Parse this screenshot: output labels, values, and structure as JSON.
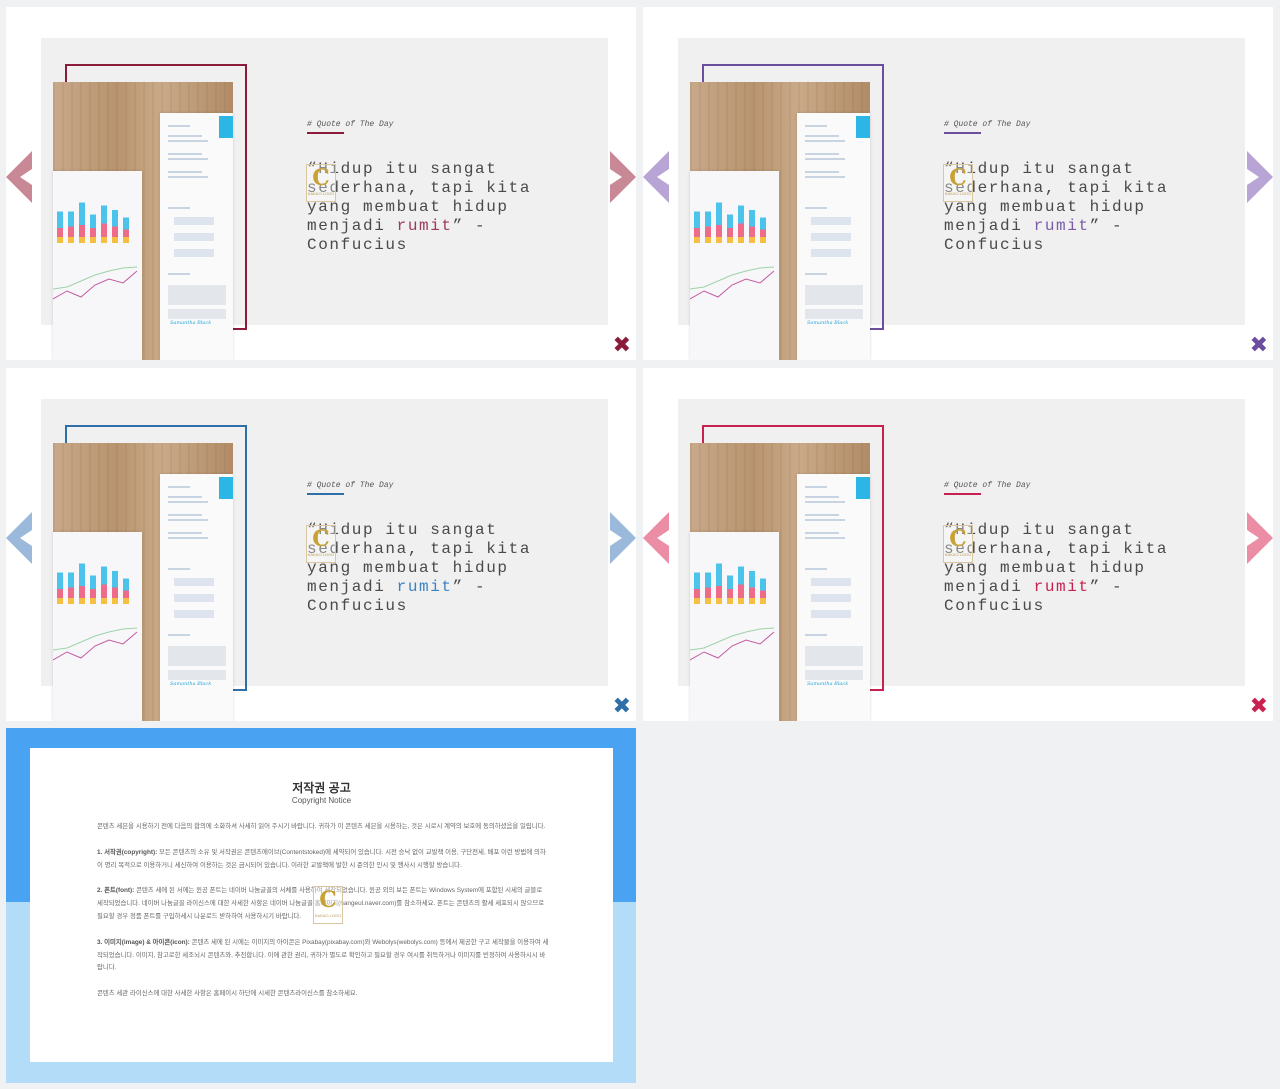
{
  "slides": [
    {
      "accent": "#8a1c3a",
      "accent2": "#9b3a59",
      "arrow_color": "#c98896",
      "quote_tag": "# Quote of The Day",
      "quote_text": "“Hidup itu sangat sederhana, tapi kita yang membuat hidup menjadi ",
      "quote_highlight": "rumit",
      "quote_end": "” -Confucius"
    },
    {
      "accent": "#6b4f9e",
      "accent2": "#7a5ca8",
      "arrow_color": "#b8a5d6",
      "quote_tag": "# Quote of The Day",
      "quote_text": "“Hidup itu sangat sederhana, tapi kita yang membuat hidup menjadi ",
      "quote_highlight": "rumit",
      "quote_end": "” -Confucius"
    },
    {
      "accent": "#2f6fa8",
      "accent2": "#3b82c4",
      "arrow_color": "#9ab9db",
      "quote_tag": "# Quote of The Day",
      "quote_text": "“Hidup itu sangat sederhana, tapi kita yang membuat hidup menjadi ",
      "quote_highlight": "rumit",
      "quote_end": "” -Confucius"
    },
    {
      "accent": "#c8214f",
      "accent2": "#c8214f",
      "arrow_color": "#ec8da6",
      "quote_tag": "# Quote of The Day",
      "quote_text": "“Hidup itu sangat sederhana, tapi kita yang membuat hidup menjadi ",
      "quote_highlight": "rumit",
      "quote_end": "” -Confucius"
    }
  ],
  "photo": {
    "signature": "Samantha Black",
    "bars_cyan": [
      0.55,
      0.5,
      0.75,
      0.45,
      0.6,
      0.55,
      0.4
    ],
    "bars_pink": [
      0.3,
      0.35,
      0.4,
      0.3,
      0.45,
      0.35,
      0.25
    ],
    "bars_yellow": [
      0.2,
      0.2,
      0.2,
      0.2,
      0.2,
      0.2,
      0.2
    ]
  },
  "watermark": {
    "letter": "C",
    "text": "KAKAO LOGO"
  },
  "icons": {
    "close": "close-x-icon",
    "left": "chevron-left-icon",
    "right": "chevron-right-icon"
  },
  "copyright": {
    "title": "저작권 공고",
    "subtitle": "Copyright Notice",
    "intro": "콘텐츠 세븐을 시용하기 전에 다음의 합의에 소화하셔 사세히 읽어 주시기 바랍니다. 귀하가 이 콘텐츠 세븐을 시용하는, 것은 시로시 계약의 보호에 동의하셨음을 일립니다.",
    "s1_head": "1. 서작권(copyright):",
    "s1_body": " 모든 콘텐츠의 소유 및 서작권은 콘텐츠에이브(Contentstoked)에 세약되어 있습니다. 시전 승낙 없이 교발책 이용, 구단전세, 배포 이런 방법에 의하이 명리 목적으로 이용하거니 세신하여 이용하는 것은 금시되어 있습니다. 이러한 교발책에 발한 시 준의한 인시 및 행사시 시행할 방습니다.",
    "s2_head": "2. 폰트(font):",
    "s2_body": " 콘텐츠 세에 된 서에는 윈공 폰트는 네이버 나눔글꼴의 서체를 사용하여 세작되었습니다. 윈공 외의 보든 폰트는 Windows System에 포함된 시세의 글블로 세작되었습니다. 네이버 나눔글꼴 라이신스에 대한 사세한 사항은 네이버 나눔글꼴 홈페이지(hangeul.naver.com)를 참소하세요. 폰트는 콘텐츠의 활세 세포되시 않으므로 필요할 경우 정품 폰트를 구입하세시 나운로드 받하하여 사용하시기 바랍니다.",
    "s3_head": "3. 이미지(image) & 아이콘(icon):",
    "s3_body": " 콘텐츠 세에 된 시에는 이미지의 아이콘은 Pixabay(pixabay.com)와 Webolys(webolys.com) 등에서 제공한 구고 세작물을 이용하여 세작되었습니다. 이미지, 참고로한 세조뇌시 콘텐츠와, 추천합니다. 이에 관한 권리, 귀하가 별도로 확인하고 필요할 경우 여시를 취득하거나 이미지를 빈정하여 사용하시시 바랍니다.",
    "outro": "콘텐츠 세관 라이신스에 대한 사세한 사항은 홈페이시 하단에 시세한 콘텐츠라이신스를 참소하세요."
  }
}
